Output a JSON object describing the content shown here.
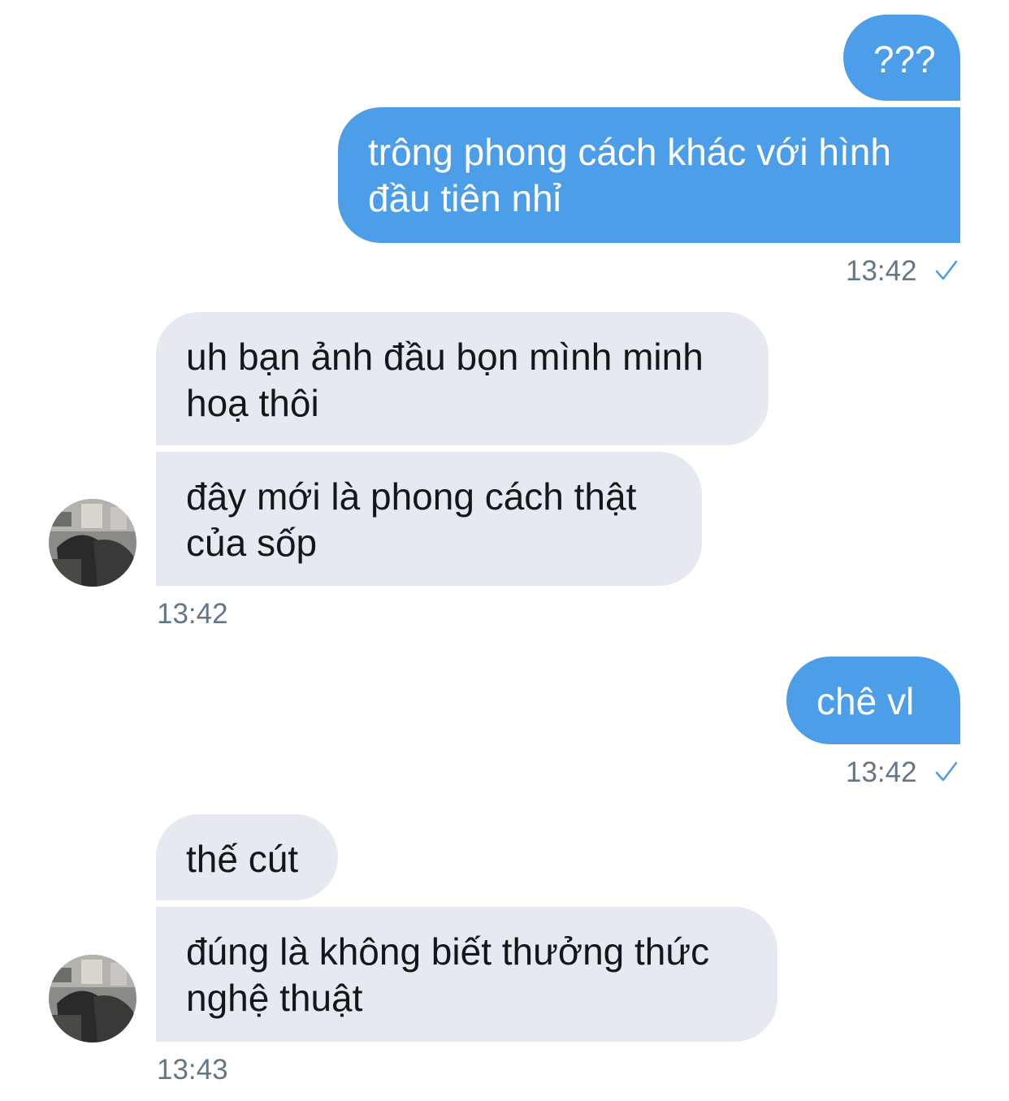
{
  "messages": [
    {
      "sender": "self",
      "text": "???"
    },
    {
      "sender": "self",
      "lines": [
        "trông phong cách khác với hình",
        "đầu tiên nhỉ"
      ],
      "time": "13:42",
      "status": "seen-check-icon"
    },
    {
      "sender": "other",
      "lines": [
        "uh bạn ảnh đầu bọn mình minh",
        "hoạ thôi"
      ]
    },
    {
      "sender": "other",
      "lines": [
        "đây mới là phong cách thật",
        "của sốp"
      ],
      "time": "13:42"
    },
    {
      "sender": "self",
      "text": "chê vl",
      "time": "13:42",
      "status": "seen-check-icon"
    },
    {
      "sender": "other",
      "text": "thế cút"
    },
    {
      "sender": "other",
      "lines": [
        "đúng là không biết thưởng thức",
        "nghệ thuật"
      ],
      "time": "13:43"
    }
  ],
  "colors": {
    "outgoing_bubble": "#4d9ee9",
    "incoming_bubble": "#e6e9f0",
    "timestamp": "#657786",
    "check": "#4d9ee9"
  },
  "icons": {
    "avatar": "user-avatar-photo",
    "read_receipt": "check-icon"
  }
}
